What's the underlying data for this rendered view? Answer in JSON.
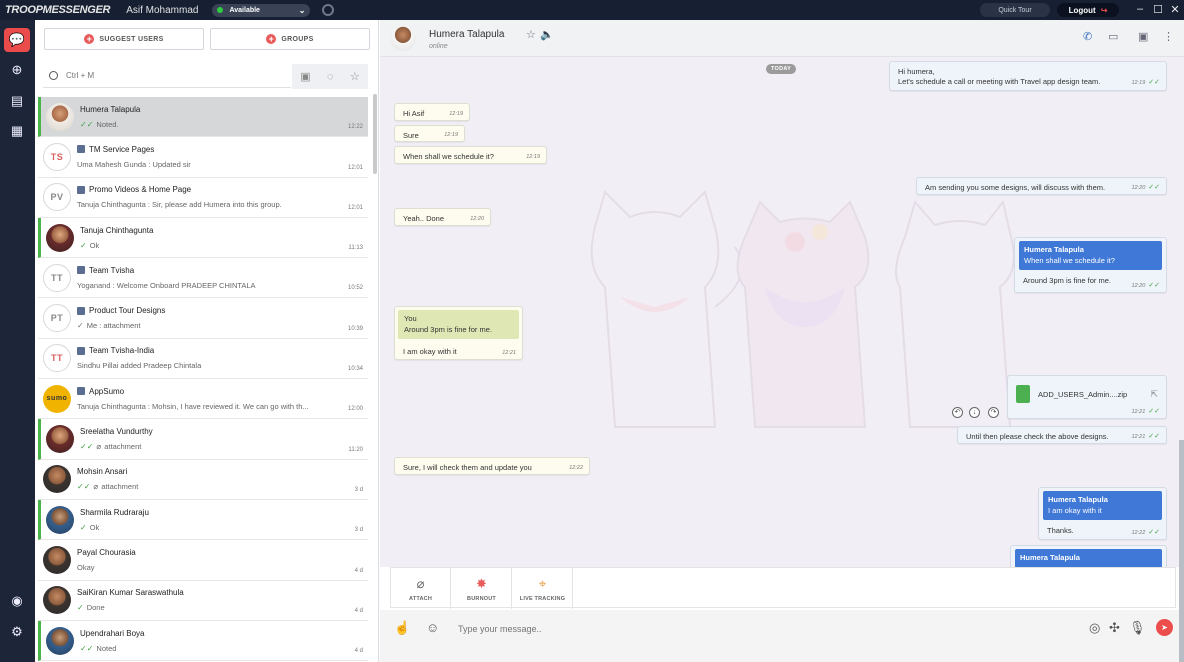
{
  "titlebar": {
    "logo": "TROOPMESSENGER",
    "user_name": "Asif Mohammad",
    "status": "Available",
    "quick_tour": "Quick Tour",
    "logout": "Logout",
    "logout_icon": "↪"
  },
  "sidebar": {
    "suggest_users": "SUGGEST USERS",
    "groups": "GROUPS",
    "search_placeholder": "Ctrl + M",
    "conversations": [
      {
        "name": "Humera Talapula",
        "preview": "Noted.",
        "time": "12:22",
        "tick": true
      },
      {
        "initials": "TS",
        "name": "TM Service Pages",
        "preview": "Uma Mahesh Gunda : Updated sir",
        "time": "12:01"
      },
      {
        "initials": "PV",
        "name": "Promo Videos & Home Page",
        "preview": "Tanuja Chinthagunta : Sir, please add Humera into this group.",
        "time": "12:01"
      },
      {
        "name": "Tanuja Chinthagunta",
        "preview": "Ok",
        "time": "11:13",
        "tick": true
      },
      {
        "initials": "TT",
        "name": "Team Tvisha",
        "preview": "Yoganand : Welcome Onboard PRADEEP CHINTALA",
        "time": "10:52"
      },
      {
        "initials": "PT",
        "name": "Product Tour Designs",
        "preview": "Me : attachment",
        "time": "10:39",
        "tick": true
      },
      {
        "initials": "TT",
        "name": "Team Tvisha-India",
        "preview": "Sindhu Pillai added Pradeep Chintala",
        "time": "10:34"
      },
      {
        "initials": "sumo",
        "name": "AppSumo",
        "preview": "Tanuja Chinthagunta : Mohsin, I have reviewed it. We can go with th...",
        "time": "12:00"
      },
      {
        "name": "Sreelatha Vundurthy",
        "preview": "attachment",
        "time": "11:20",
        "tick": true
      },
      {
        "name": "Mohsin Ansari",
        "preview": "attachment",
        "time": "3 d",
        "tick": true
      },
      {
        "name": "Sharmila Rudraraju",
        "preview": "Ok",
        "time": "3 d",
        "tick": true
      },
      {
        "name": "Payal Chourasia",
        "preview": "Okay",
        "time": "4 d"
      },
      {
        "name": "SaiKiran Kumar Saraswathula",
        "preview": "Done",
        "time": "4 d",
        "tick": true
      },
      {
        "name": "Upendrahari Boya",
        "preview": "Noted",
        "time": "4 d",
        "tick": true
      }
    ]
  },
  "chat": {
    "contact_name": "Humera Talapula",
    "contact_status": "online",
    "day_label": "TODAY",
    "messages": {
      "m1_line1": "Hi humera,",
      "m1_line2": "Let's schedule a call or meeting with Travel app design team.",
      "m1_time": "12:19",
      "m2": "Hi Asif",
      "m2_time": "12:19",
      "m3": "Sure",
      "m3_time": "12:19",
      "m4": "When shall we schedule it?",
      "m4_time": "12:19",
      "m5": "Am sending you some designs, will discuss with them.",
      "m5_time": "12:20",
      "m6": "Yeah.. Done",
      "m6_time": "12:20",
      "m7_quote_name": "Humera Talapula",
      "m7_quote_text": "When shall we schedule it?",
      "m7": "Around 3pm is fine for me.",
      "m7_time": "12:20",
      "m8_quote_name": "You",
      "m8_quote_text": "Around 3pm is fine for me.",
      "m8": "I am okay with it",
      "m8_time": "12:21",
      "m9_file": "ADD_USERS_Admin....zip",
      "m9_time": "12:21",
      "m10": "Until then please check the above designs.",
      "m10_time": "12:21",
      "m11": "Sure, I will check them and update you",
      "m11_time": "12:22",
      "m12_quote_name": "Humera Talapula",
      "m12_quote_text": "I am okay with it",
      "m12": "Thanks.",
      "m12_time": "12:22",
      "m13_quote_name": "Humera Talapula"
    }
  },
  "compose": {
    "attach": "ATTACH",
    "burnout": "BURNOUT",
    "live_tracking": "LIVE TRACKING",
    "placeholder": "Type your message.."
  },
  "colors": {
    "titlebar_bg": "#172033",
    "accent_red": "#ea4c4c",
    "online_green": "#2ecc40",
    "quote_blue": "#3f78d6"
  }
}
